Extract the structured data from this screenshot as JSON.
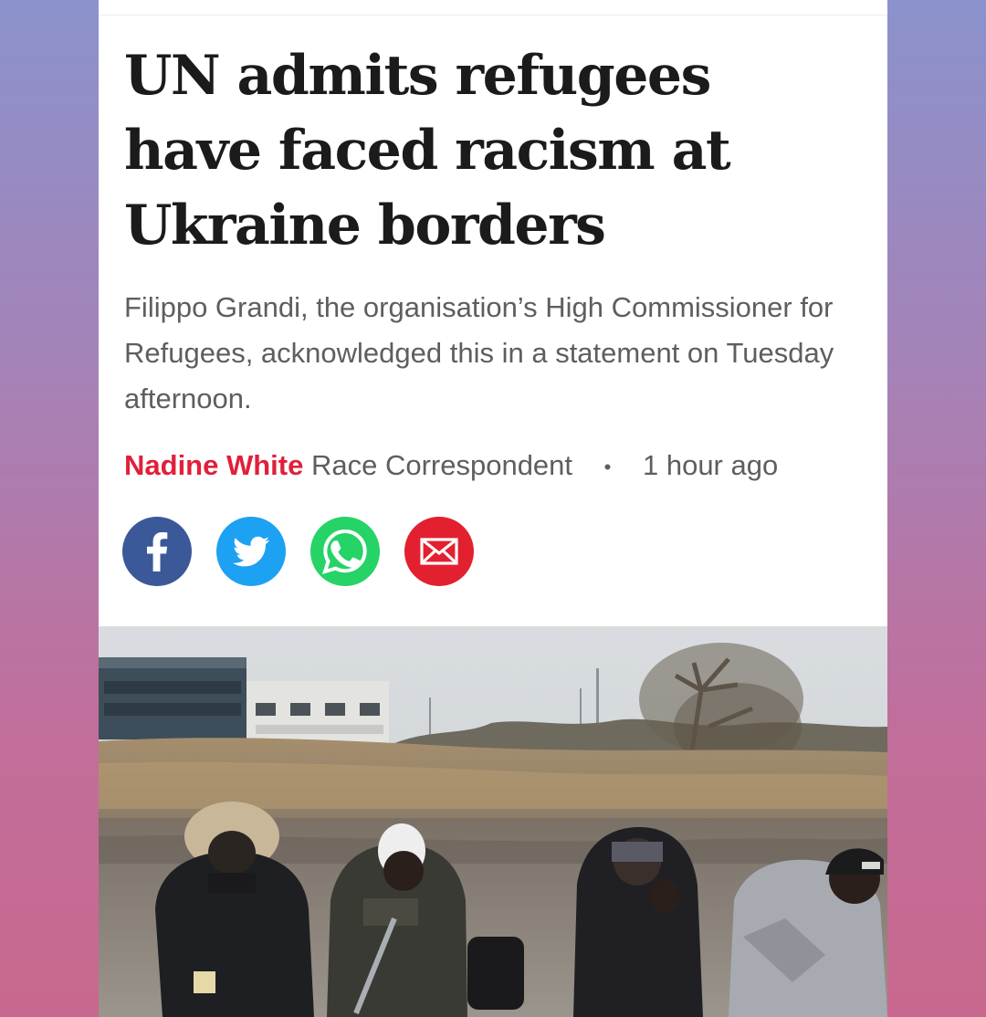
{
  "article": {
    "headline": "UN admits refugees have faced racism at Ukraine borders",
    "standfirst": "Filippo Grandi, the organisation’s High Commissioner for Refugees, acknowledged this in a statement on Tuesday afternoon.",
    "author": "Nadine White",
    "author_role": "Race Correspondent",
    "separator": "•",
    "timestamp": "1 hour ago"
  },
  "share": [
    {
      "icon": "facebook-icon",
      "color": "#3b5998"
    },
    {
      "icon": "twitter-icon",
      "color": "#1da1f2"
    },
    {
      "icon": "whatsapp-icon",
      "color": "#25d366"
    },
    {
      "icon": "email-icon",
      "color": "#e3202f"
    }
  ],
  "colors": {
    "accent": "#e0203a",
    "headline": "#1b1b1b",
    "body_text": "#5e5e5e"
  }
}
